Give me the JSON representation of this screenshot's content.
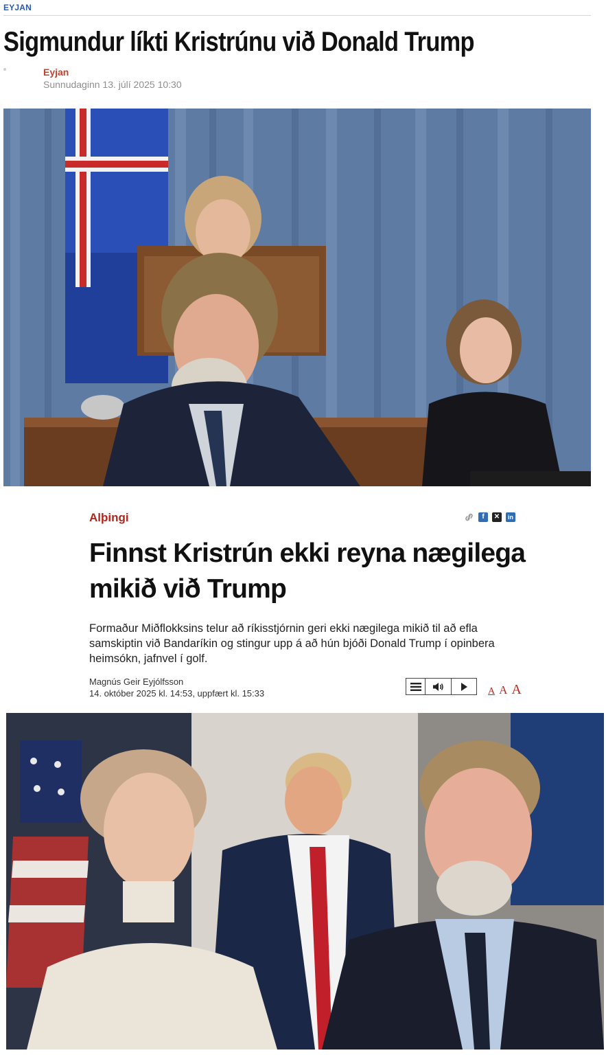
{
  "article1": {
    "section": "EYJAN",
    "title": "Sigmundur líkti Kristrúnu við Donald Trump",
    "author": "Eyjan",
    "date": "Sunnudaginn 13. júlí 2025 10:30"
  },
  "article2": {
    "section": "Alþingi",
    "share_icons": [
      "link-icon",
      "facebook-icon",
      "x-icon",
      "linkedin-icon"
    ],
    "title": "Finnst Kristrún ekki reyna nægilega mikið við Trump",
    "lede": "Formaður Miðflokksins telur að ríkisstjórnin geri ekki nægilega mikið til að efla samskiptin við Bandaríkin og stingur upp á að hún bjóði Donald Trump í opinbera heimsókn, jafnvel í golf.",
    "author": "Magnús Geir Eyjólfsson",
    "date": "14. október 2025 kl. 14:53, uppfært kl. 15:33",
    "player_icons": [
      "menu-icon",
      "speaker-icon",
      "play-icon"
    ],
    "font_size_labels": [
      "A",
      "A",
      "A"
    ]
  },
  "colors": {
    "eyjan_blue": "#2a5aa8",
    "eyjan_author_red": "#c4422b",
    "section_red": "#b3241b",
    "fontsize_red": "#c0281c"
  }
}
